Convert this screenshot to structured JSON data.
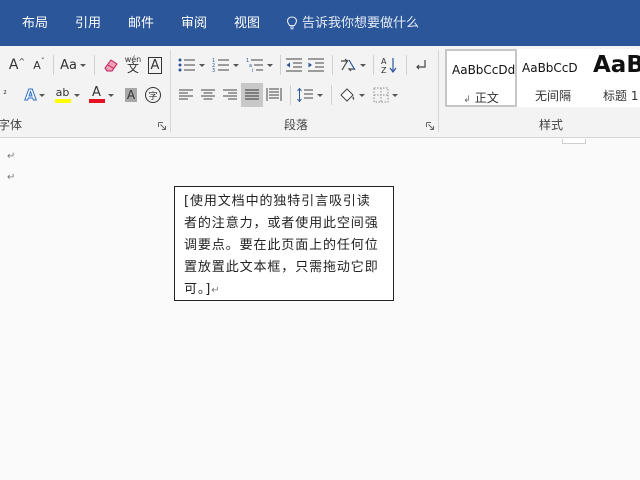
{
  "menubar": {
    "tabs": [
      "布局",
      "引用",
      "邮件",
      "审阅",
      "视图"
    ],
    "tellme": "告诉我你想要做什么"
  },
  "ribbon": {
    "font_group_label": "字体",
    "paragraph_group_label": "段落",
    "styles_group_label": "样式",
    "font_size_grow": "A",
    "font_size_shrink": "A",
    "change_case": "Aa",
    "phonetic_top": "wén",
    "phonetic_bottom": "文",
    "char_border": "A",
    "text_effects": "A",
    "highlight": "ab",
    "font_color": "A",
    "char_shading": "A",
    "enclose_char": "字",
    "sort_icon_label": "A↓Z"
  },
  "styles": [
    {
      "sample": "AaBbCcDd",
      "name": "正文"
    },
    {
      "sample": "AaBbCcD",
      "name": "无间隔"
    },
    {
      "sample": "AaB",
      "name": "标题 1"
    }
  ],
  "document": {
    "paragraph_mark": "↵",
    "textbox_text": "[使用文档中的独特引言吸引读者的注意力，或者使用此空间强调要点。要在此页面上的任何位置放置此文本框，只需拖动它即可。]",
    "textbox_end_mark": "↵"
  },
  "colors": {
    "menubar": "#2b579a",
    "highlight_yellow": "#ffff00",
    "font_color_red": "#e81123"
  }
}
